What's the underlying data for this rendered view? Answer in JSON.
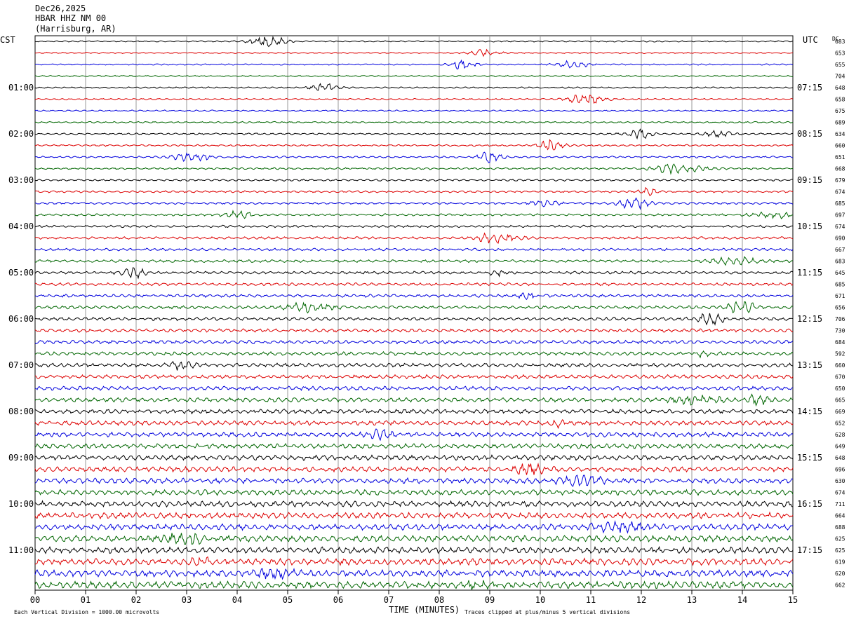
{
  "chart_data": {
    "type": "line",
    "title": "Dec26,2025",
    "station": "HBAR HHZ NM 00",
    "location": "(Harrisburg, AR)",
    "left_timezone": "CST",
    "right_timezone": "UTC",
    "dc_label": "DC",
    "xlabel": "TIME (MINUTES)",
    "x_ticks": [
      "00",
      "01",
      "02",
      "03",
      "04",
      "05",
      "06",
      "07",
      "08",
      "09",
      "10",
      "11",
      "12",
      "13",
      "14",
      "15"
    ],
    "xlim": [
      0,
      15
    ],
    "left_hour_labels": [
      "01:00",
      "02:00",
      "03:00",
      "04:00",
      "05:00",
      "06:00",
      "07:00",
      "08:00",
      "09:00",
      "10:00",
      "11:00"
    ],
    "right_hour_labels": [
      "07:15",
      "08:15",
      "09:15",
      "10:15",
      "11:15",
      "12:15",
      "13:15",
      "14:15",
      "15:15",
      "16:15",
      "17:15"
    ],
    "dc_offsets": [
      683,
      653,
      655,
      704,
      648,
      658,
      675,
      689,
      634,
      660,
      651,
      668,
      679,
      674,
      685,
      697,
      674,
      690,
      667,
      683,
      645,
      685,
      671,
      656,
      706,
      730,
      684,
      592,
      660,
      670,
      650,
      665,
      669,
      652,
      628,
      649,
      648,
      696,
      630,
      674,
      711,
      664,
      688,
      625,
      625,
      619,
      620,
      662
    ],
    "trace_colors": [
      "#000000",
      "#dd0000",
      "#0000dd",
      "#006600"
    ],
    "footer_left": "Each Vertical Division = 1000.00 microvolts",
    "footer_right": "Traces clipped at plus/minus 5 vertical divisions",
    "grid": true
  }
}
